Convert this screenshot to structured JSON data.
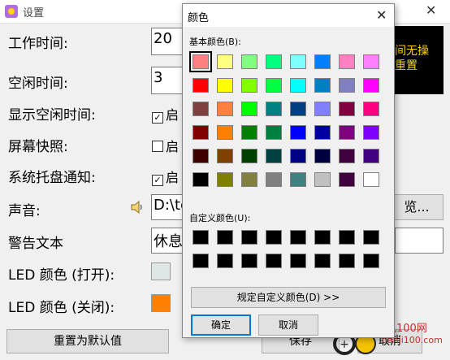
{
  "window": {
    "title": "设置",
    "labels": {
      "work_time": "工作时间:",
      "idle_time": "空闲时间:",
      "show_idle": "显示空闲时间:",
      "screenshot": "屏幕快照:",
      "tray_notify": "系统托盘通知:",
      "sound": "声音:",
      "warning_text": "警告文本",
      "led_on": "LED 颜色 (打开):",
      "led_off": "LED 颜色 (关闭):"
    },
    "work_time_value": "20",
    "idle_time_value": "3",
    "show_idle_check": "启",
    "screenshot_check": "启",
    "tray_check": "启",
    "sound_path": "D:\\tc",
    "browse_label": "览...",
    "warning_value": "休息",
    "reset_button": "重置为默认值",
    "save_button": "保存",
    "cancel_button": "取消",
    "preview_text_line1": "间无操",
    "preview_text_line2": "重置",
    "colors": {
      "led_on": "#dfe6e6",
      "led_off": "#ff8000",
      "preview_bg": "#000000",
      "preview_text": "#ffd400"
    }
  },
  "color_dialog": {
    "title": "颜色",
    "basic_label": "基本颜色(B):",
    "custom_label": "自定义颜色(U):",
    "define_custom_button": "规定自定义颜色(D) >>",
    "ok_button": "确定",
    "cancel_button": "取消",
    "basic_colors": [
      [
        "#ff8080",
        "#ffff80",
        "#80ff80",
        "#00ff80",
        "#80ffff",
        "#0080ff",
        "#ff80c0",
        "#ff80ff"
      ],
      [
        "#ff0000",
        "#ffff00",
        "#80ff00",
        "#00ff40",
        "#00ffff",
        "#0080c0",
        "#8080c0",
        "#ff00ff"
      ],
      [
        "#804040",
        "#ff8040",
        "#00ff00",
        "#008080",
        "#004080",
        "#8080ff",
        "#800040",
        "#ff0080"
      ],
      [
        "#800000",
        "#ff8000",
        "#008000",
        "#008040",
        "#0000ff",
        "#0000a0",
        "#800080",
        "#8000ff"
      ],
      [
        "#400000",
        "#804000",
        "#004000",
        "#004040",
        "#000080",
        "#000040",
        "#400040",
        "#400080"
      ],
      [
        "#000000",
        "#808000",
        "#808040",
        "#808080",
        "#408080",
        "#c0c0c0",
        "#400040",
        "#ffffff"
      ]
    ],
    "selected_index": [
      0,
      0
    ],
    "custom_colors": [
      [
        "#000000",
        "#000000",
        "#000000",
        "#000000",
        "#000000",
        "#000000",
        "#000000",
        "#000000"
      ],
      [
        "#000000",
        "#000000",
        "#000000",
        "#000000",
        "#000000",
        "#000000",
        "#000000",
        "#000000"
      ]
    ]
  },
  "watermark": {
    "line1": "单机100网",
    "line2": "danji100.com"
  }
}
